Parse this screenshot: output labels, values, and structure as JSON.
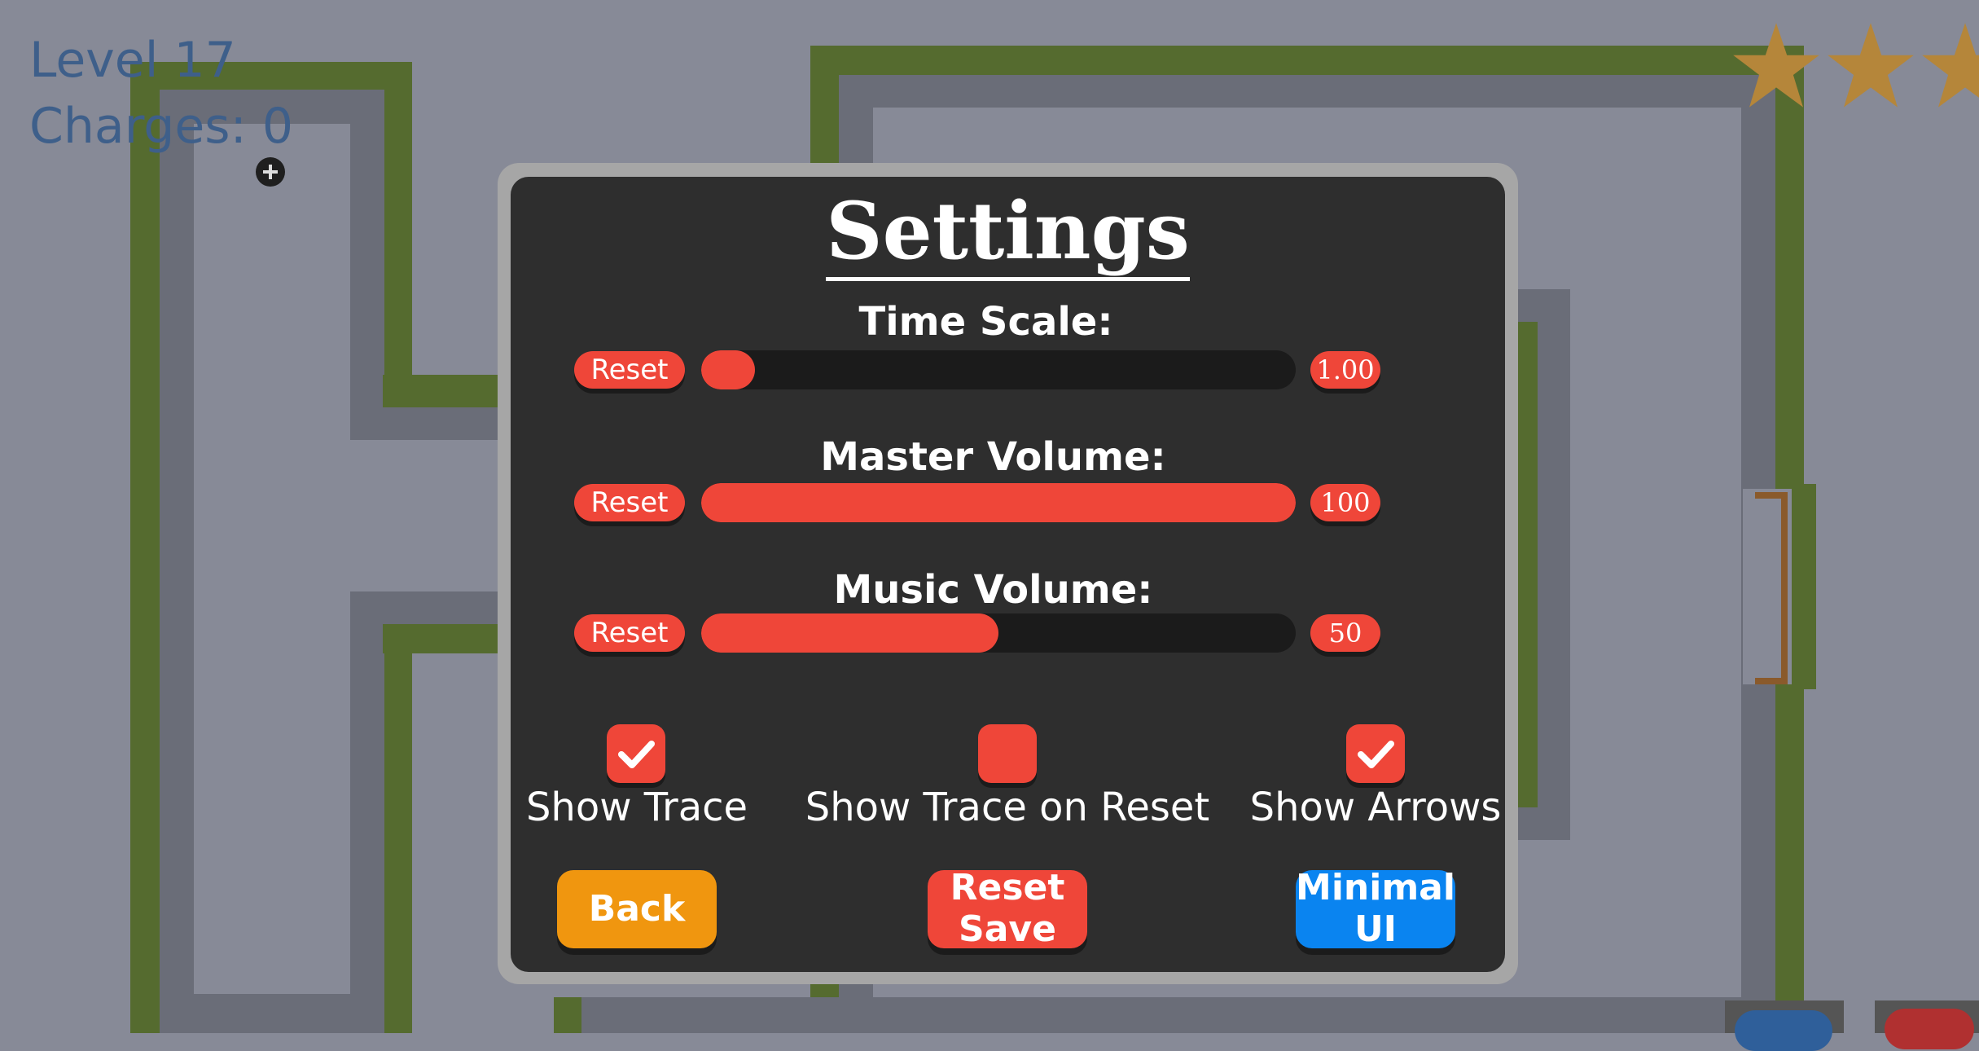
{
  "hud": {
    "level_text": "Level 17",
    "charges_text": "Charges: 0"
  },
  "stars": {
    "count_visible": 3,
    "color": "#b5863a"
  },
  "settings": {
    "title": "Settings",
    "sliders": [
      {
        "label": "Time Scale:",
        "reset_label": "Reset",
        "value_text": "1.00",
        "fill_fraction": 0.0
      },
      {
        "label": "Master Volume:",
        "reset_label": "Reset",
        "value_text": "100",
        "fill_fraction": 1.0
      },
      {
        "label": "Music Volume:",
        "reset_label": "Reset",
        "value_text": "50",
        "fill_fraction": 0.5
      }
    ],
    "toggles": [
      {
        "label": "Show Trace",
        "checked": true
      },
      {
        "label": "Show Trace on Reset",
        "checked": false
      },
      {
        "label": "Show Arrows",
        "checked": true
      }
    ],
    "buttons": {
      "back": "Back",
      "reset_save_line1": "Reset",
      "reset_save_line2": "Save",
      "minimal_ui_line1": "Minimal",
      "minimal_ui_line2": "UI"
    }
  },
  "colors": {
    "accent_red": "#ef4639",
    "back_orange": "#f0960f",
    "minimal_blue": "#0a84f0",
    "panel_dark": "#2e2e2e",
    "board_bg": "#878a97",
    "wall_green": "#556b2f",
    "hud_blue": "#3e5f8a"
  }
}
